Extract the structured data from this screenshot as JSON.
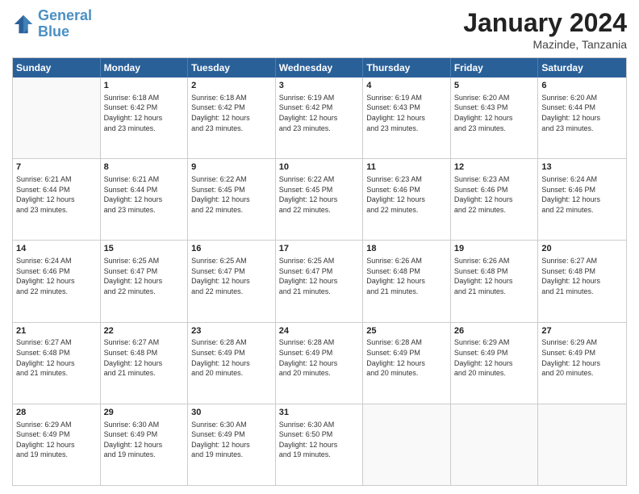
{
  "header": {
    "logo_line1": "General",
    "logo_line2": "Blue",
    "month_title": "January 2024",
    "subtitle": "Mazinde, Tanzania"
  },
  "days_of_week": [
    "Sunday",
    "Monday",
    "Tuesday",
    "Wednesday",
    "Thursday",
    "Friday",
    "Saturday"
  ],
  "weeks": [
    [
      {
        "day": "",
        "sunrise": "",
        "sunset": "",
        "daylight": ""
      },
      {
        "day": "1",
        "sunrise": "Sunrise: 6:18 AM",
        "sunset": "Sunset: 6:42 PM",
        "daylight": "Daylight: 12 hours and 23 minutes."
      },
      {
        "day": "2",
        "sunrise": "Sunrise: 6:18 AM",
        "sunset": "Sunset: 6:42 PM",
        "daylight": "Daylight: 12 hours and 23 minutes."
      },
      {
        "day": "3",
        "sunrise": "Sunrise: 6:19 AM",
        "sunset": "Sunset: 6:42 PM",
        "daylight": "Daylight: 12 hours and 23 minutes."
      },
      {
        "day": "4",
        "sunrise": "Sunrise: 6:19 AM",
        "sunset": "Sunset: 6:43 PM",
        "daylight": "Daylight: 12 hours and 23 minutes."
      },
      {
        "day": "5",
        "sunrise": "Sunrise: 6:20 AM",
        "sunset": "Sunset: 6:43 PM",
        "daylight": "Daylight: 12 hours and 23 minutes."
      },
      {
        "day": "6",
        "sunrise": "Sunrise: 6:20 AM",
        "sunset": "Sunset: 6:44 PM",
        "daylight": "Daylight: 12 hours and 23 minutes."
      }
    ],
    [
      {
        "day": "7",
        "sunrise": "Sunrise: 6:21 AM",
        "sunset": "Sunset: 6:44 PM",
        "daylight": "Daylight: 12 hours and 23 minutes."
      },
      {
        "day": "8",
        "sunrise": "Sunrise: 6:21 AM",
        "sunset": "Sunset: 6:44 PM",
        "daylight": "Daylight: 12 hours and 23 minutes."
      },
      {
        "day": "9",
        "sunrise": "Sunrise: 6:22 AM",
        "sunset": "Sunset: 6:45 PM",
        "daylight": "Daylight: 12 hours and 22 minutes."
      },
      {
        "day": "10",
        "sunrise": "Sunrise: 6:22 AM",
        "sunset": "Sunset: 6:45 PM",
        "daylight": "Daylight: 12 hours and 22 minutes."
      },
      {
        "day": "11",
        "sunrise": "Sunrise: 6:23 AM",
        "sunset": "Sunset: 6:46 PM",
        "daylight": "Daylight: 12 hours and 22 minutes."
      },
      {
        "day": "12",
        "sunrise": "Sunrise: 6:23 AM",
        "sunset": "Sunset: 6:46 PM",
        "daylight": "Daylight: 12 hours and 22 minutes."
      },
      {
        "day": "13",
        "sunrise": "Sunrise: 6:24 AM",
        "sunset": "Sunset: 6:46 PM",
        "daylight": "Daylight: 12 hours and 22 minutes."
      }
    ],
    [
      {
        "day": "14",
        "sunrise": "Sunrise: 6:24 AM",
        "sunset": "Sunset: 6:46 PM",
        "daylight": "Daylight: 12 hours and 22 minutes."
      },
      {
        "day": "15",
        "sunrise": "Sunrise: 6:25 AM",
        "sunset": "Sunset: 6:47 PM",
        "daylight": "Daylight: 12 hours and 22 minutes."
      },
      {
        "day": "16",
        "sunrise": "Sunrise: 6:25 AM",
        "sunset": "Sunset: 6:47 PM",
        "daylight": "Daylight: 12 hours and 22 minutes."
      },
      {
        "day": "17",
        "sunrise": "Sunrise: 6:25 AM",
        "sunset": "Sunset: 6:47 PM",
        "daylight": "Daylight: 12 hours and 21 minutes."
      },
      {
        "day": "18",
        "sunrise": "Sunrise: 6:26 AM",
        "sunset": "Sunset: 6:48 PM",
        "daylight": "Daylight: 12 hours and 21 minutes."
      },
      {
        "day": "19",
        "sunrise": "Sunrise: 6:26 AM",
        "sunset": "Sunset: 6:48 PM",
        "daylight": "Daylight: 12 hours and 21 minutes."
      },
      {
        "day": "20",
        "sunrise": "Sunrise: 6:27 AM",
        "sunset": "Sunset: 6:48 PM",
        "daylight": "Daylight: 12 hours and 21 minutes."
      }
    ],
    [
      {
        "day": "21",
        "sunrise": "Sunrise: 6:27 AM",
        "sunset": "Sunset: 6:48 PM",
        "daylight": "Daylight: 12 hours and 21 minutes."
      },
      {
        "day": "22",
        "sunrise": "Sunrise: 6:27 AM",
        "sunset": "Sunset: 6:48 PM",
        "daylight": "Daylight: 12 hours and 21 minutes."
      },
      {
        "day": "23",
        "sunrise": "Sunrise: 6:28 AM",
        "sunset": "Sunset: 6:49 PM",
        "daylight": "Daylight: 12 hours and 20 minutes."
      },
      {
        "day": "24",
        "sunrise": "Sunrise: 6:28 AM",
        "sunset": "Sunset: 6:49 PM",
        "daylight": "Daylight: 12 hours and 20 minutes."
      },
      {
        "day": "25",
        "sunrise": "Sunrise: 6:28 AM",
        "sunset": "Sunset: 6:49 PM",
        "daylight": "Daylight: 12 hours and 20 minutes."
      },
      {
        "day": "26",
        "sunrise": "Sunrise: 6:29 AM",
        "sunset": "Sunset: 6:49 PM",
        "daylight": "Daylight: 12 hours and 20 minutes."
      },
      {
        "day": "27",
        "sunrise": "Sunrise: 6:29 AM",
        "sunset": "Sunset: 6:49 PM",
        "daylight": "Daylight: 12 hours and 20 minutes."
      }
    ],
    [
      {
        "day": "28",
        "sunrise": "Sunrise: 6:29 AM",
        "sunset": "Sunset: 6:49 PM",
        "daylight": "Daylight: 12 hours and 19 minutes."
      },
      {
        "day": "29",
        "sunrise": "Sunrise: 6:30 AM",
        "sunset": "Sunset: 6:49 PM",
        "daylight": "Daylight: 12 hours and 19 minutes."
      },
      {
        "day": "30",
        "sunrise": "Sunrise: 6:30 AM",
        "sunset": "Sunset: 6:49 PM",
        "daylight": "Daylight: 12 hours and 19 minutes."
      },
      {
        "day": "31",
        "sunrise": "Sunrise: 6:30 AM",
        "sunset": "Sunset: 6:50 PM",
        "daylight": "Daylight: 12 hours and 19 minutes."
      },
      {
        "day": "",
        "sunrise": "",
        "sunset": "",
        "daylight": ""
      },
      {
        "day": "",
        "sunrise": "",
        "sunset": "",
        "daylight": ""
      },
      {
        "day": "",
        "sunrise": "",
        "sunset": "",
        "daylight": ""
      }
    ]
  ]
}
